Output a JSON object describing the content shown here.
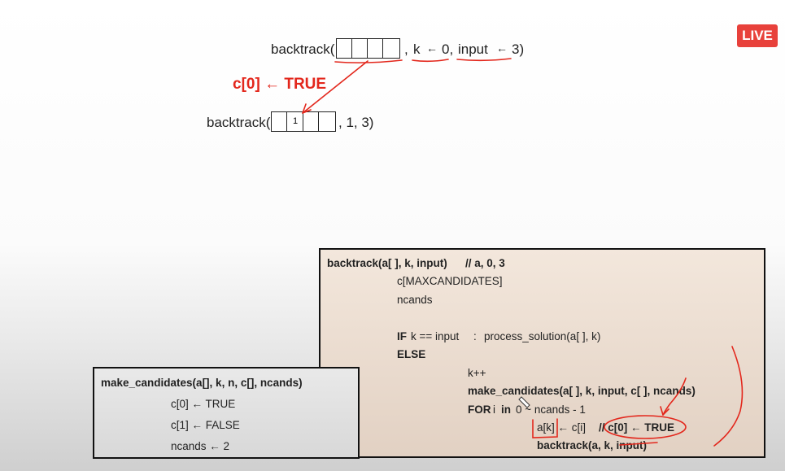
{
  "badge": {
    "live": "LIVE"
  },
  "top_call": {
    "prefix": "backtrack(",
    "sep1": ",",
    "k_label": "k",
    "arrow1": "←",
    "k_value": "0,",
    "input_label": "input",
    "arrow2": "←",
    "input_value": "3)"
  },
  "assign_label": "c[0] ← TRUE",
  "second_call": {
    "prefix": "backtrack(",
    "cell_value": "1",
    "suffix": ", 1, 3)"
  },
  "code": {
    "header": "backtrack(a[ ], k, input)",
    "header_comment": "// a, 0, 3",
    "l1": "c[MAXCANDIDATES]",
    "l2": "ncands",
    "if_kw": "IF",
    "if_cond": "k == input",
    "if_colon": ":",
    "if_body": "process_solution(a[ ], k)",
    "else_kw": "ELSE",
    "l_kpp": "k++",
    "l_mc": "make_candidates(a[ ], k, input, c[ ], ncands)",
    "for_kw": "FOR",
    "for_var": "i",
    "in_kw": "in",
    "for_range": "0 ~ ncands - 1",
    "assign_a": "a[k] ← c[i]",
    "comment_a": "// c[0] ← TRUE",
    "recurse": "backtrack(a, k, input)"
  },
  "make_candidates": {
    "header": "make_candidates(a[], k, n, c[], ncands)",
    "l1": "c[0] ← TRUE",
    "l2": "c[1] ← FALSE",
    "l3": "ncands ← 2"
  },
  "colors": {
    "accent_red": "#e3271c",
    "live_red": "#e8413b"
  }
}
